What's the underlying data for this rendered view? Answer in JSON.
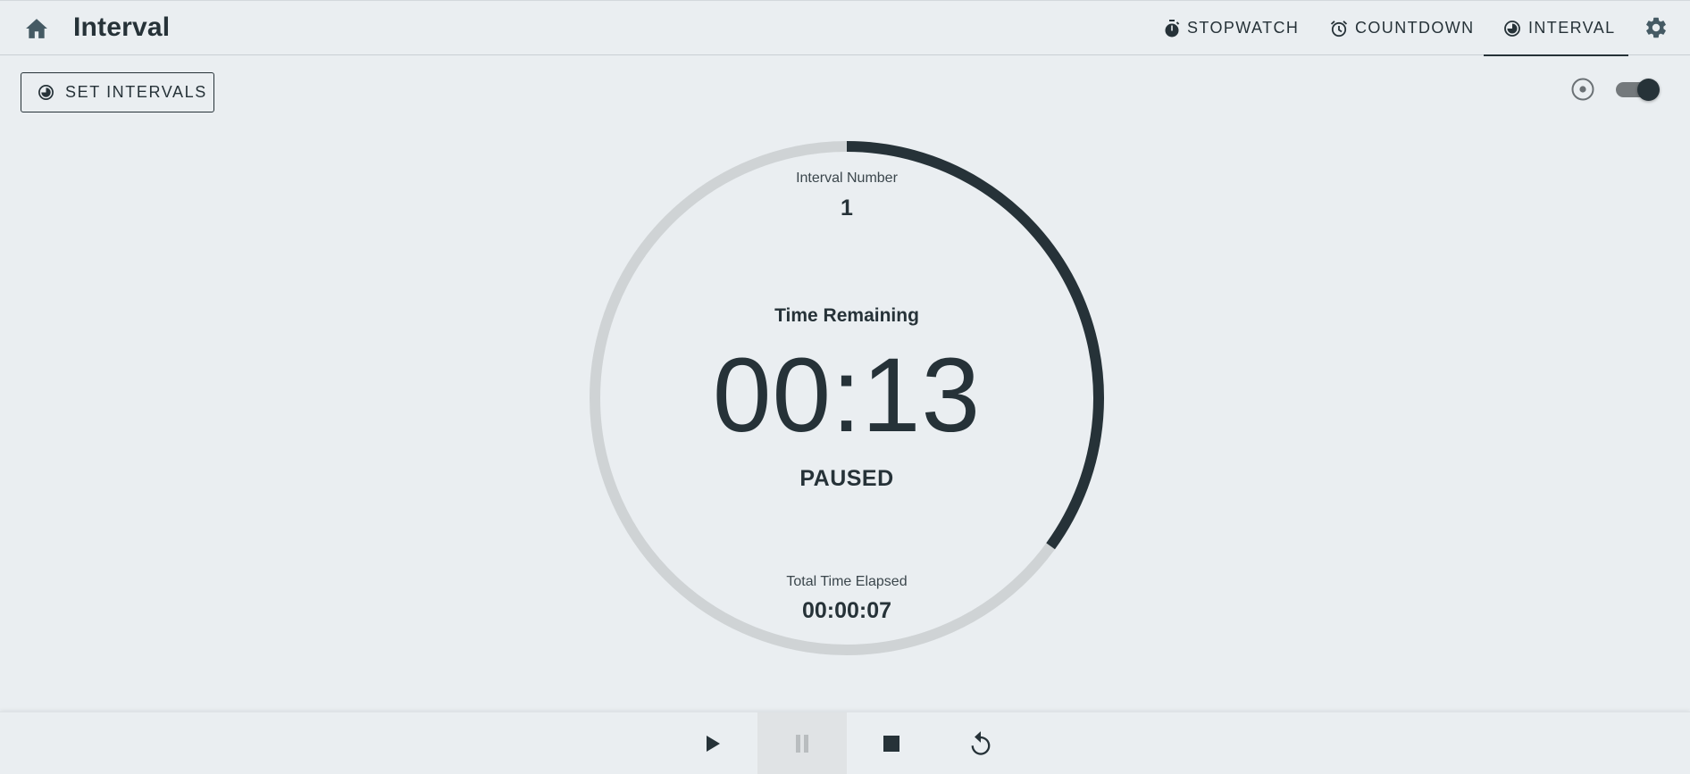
{
  "header": {
    "title": "Interval",
    "tabs": [
      {
        "label": "STOPWATCH",
        "icon": "stopwatch-icon",
        "active": false
      },
      {
        "label": "COUNTDOWN",
        "icon": "alarm-clock-icon",
        "active": false
      },
      {
        "label": "INTERVAL",
        "icon": "interval-icon",
        "active": true
      }
    ]
  },
  "toolbar": {
    "set_intervals_label": "SET INTERVALS",
    "toggle_on": true
  },
  "timer": {
    "interval_number_label": "Interval Number",
    "interval_number": "1",
    "time_remaining_label": "Time Remaining",
    "time_remaining": "00:13",
    "status": "PAUSED",
    "total_elapsed_label": "Total Time Elapsed",
    "total_elapsed": "00:00:07",
    "progress_fraction": 0.35
  },
  "controls": [
    {
      "name": "play-button",
      "icon": "play-icon"
    },
    {
      "name": "pause-button",
      "icon": "pause-icon",
      "disabled": true
    },
    {
      "name": "stop-button",
      "icon": "stop-icon"
    },
    {
      "name": "reset-button",
      "icon": "replay-icon"
    }
  ],
  "colors": {
    "background": "#eaeef1",
    "primary": "#263238",
    "track": "#cfd3d5"
  }
}
